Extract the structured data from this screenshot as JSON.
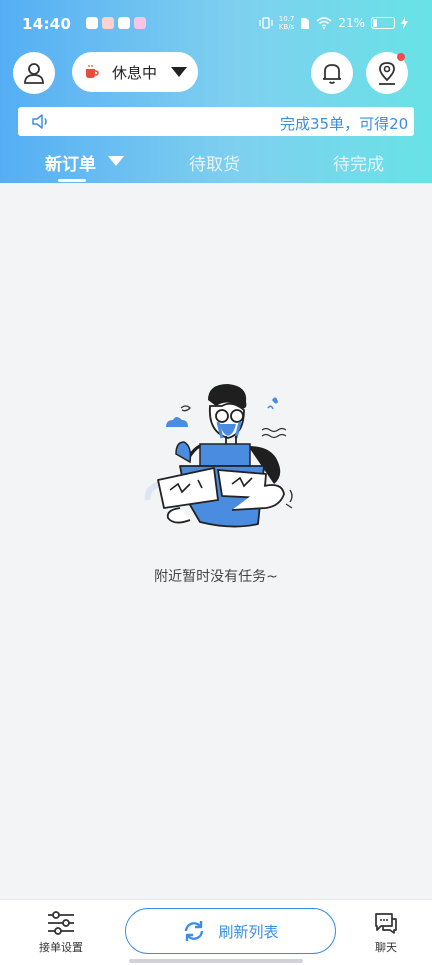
{
  "status_bar": {
    "time": "14:40",
    "net_speed_value": "10.7",
    "net_speed_unit": "KB/s",
    "battery": "21%",
    "battery_level": 0.21
  },
  "header": {
    "rider_status": "休息中",
    "notice_text": "完成35单，可得20"
  },
  "tabs": [
    {
      "label": "新订单",
      "active": true
    },
    {
      "label": "待取货",
      "active": false
    },
    {
      "label": "待完成",
      "active": false
    }
  ],
  "empty_state": {
    "message": "附近暂时没有任务~"
  },
  "bottom_bar": {
    "settings_label": "接单设置",
    "refresh_label": "刷新列表",
    "chat_label": "聊天"
  },
  "colors": {
    "accent": "#3a8ee6",
    "header_gradient_start": "#55aef4",
    "header_gradient_end": "#68e2e6",
    "badge_red": "#f24b4b"
  },
  "icons": [
    "user-icon",
    "coffee-cup-icon",
    "dropdown-arrow-icon",
    "bell-icon",
    "location-pin-icon",
    "speaker-icon",
    "sliders-icon",
    "refresh-icon",
    "chat-bubble-icon"
  ]
}
